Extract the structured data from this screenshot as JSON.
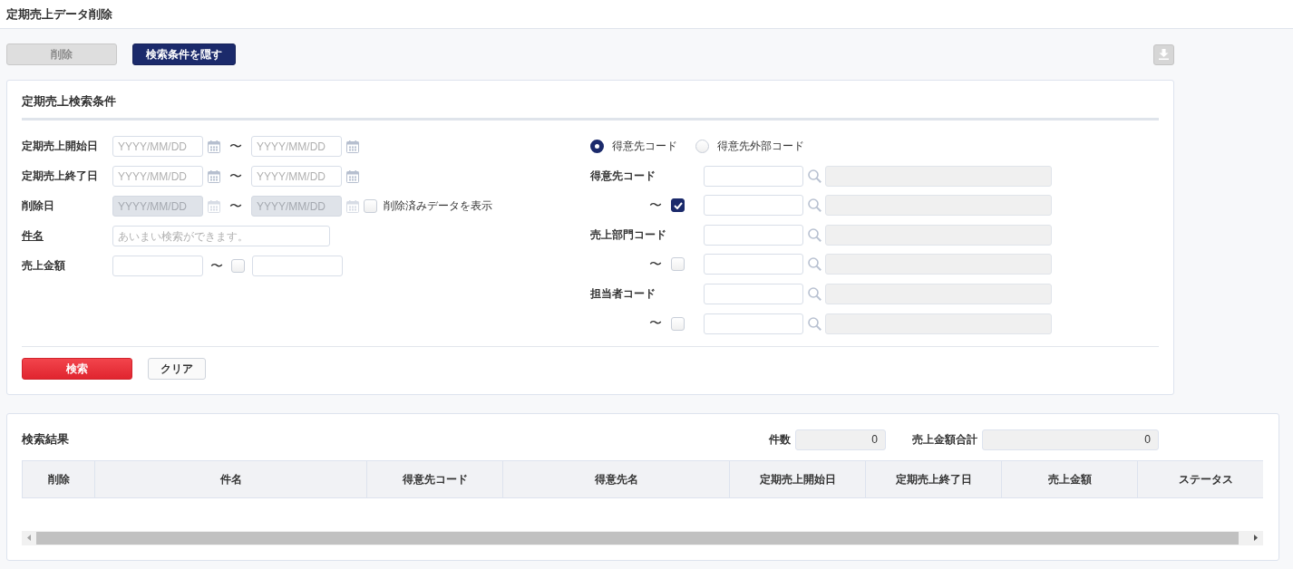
{
  "page": {
    "title": "定期売上データ削除"
  },
  "toolbar": {
    "buttons": [
      {
        "label": "削除",
        "kind": "plain",
        "disabled": true
      },
      {
        "label": "検索条件を隠す",
        "kind": "primary",
        "disabled": false
      }
    ],
    "download_button": {
      "disabled": true
    }
  },
  "search_panel": {
    "title": "定期売上検索条件",
    "left_rows": [
      {
        "kind": "date_range",
        "label": "定期売上開始日",
        "link": false,
        "from_placeholder": "YYYY/MM/DD",
        "separator": "〜",
        "to_placeholder": "YYYY/MM/DD",
        "disabled": false
      },
      {
        "kind": "date_range",
        "label": "定期売上終了日",
        "link": false,
        "from_placeholder": "YYYY/MM/DD",
        "separator": "〜",
        "to_placeholder": "YYYY/MM/DD",
        "disabled": false
      },
      {
        "kind": "date_range",
        "label": "削除日",
        "link": false,
        "from_placeholder": "YYYY/MM/DD",
        "separator": "〜",
        "to_placeholder": "YYYY/MM/DD",
        "disabled": true,
        "option": {
          "label": "削除済みデータを表示",
          "checked": false
        }
      },
      {
        "kind": "text",
        "label": "件名",
        "link": true,
        "placeholder": "あいまい検索ができます。"
      },
      {
        "kind": "amount_range",
        "label": "売上金額",
        "link": false,
        "separator": "〜",
        "checked": false
      }
    ],
    "code_type": [
      {
        "label": "得意先コード",
        "selected": true
      },
      {
        "label": "得意先外部コード",
        "selected": false
      }
    ],
    "code_groups": [
      {
        "label": "得意先コード",
        "separator": "〜",
        "checked": true
      },
      {
        "label": "売上部門コード",
        "separator": "〜",
        "checked": false
      },
      {
        "label": "担当者コード",
        "separator": "〜",
        "checked": false
      }
    ],
    "buttons": [
      {
        "label": "検索",
        "kind": "danger",
        "disabled": false
      },
      {
        "label": "クリア",
        "kind": "plain",
        "disabled": false
      }
    ]
  },
  "results": {
    "title": "検索結果",
    "totals": [
      {
        "label": "件数",
        "value": "0"
      },
      {
        "label": "売上金額合計",
        "value": "0"
      }
    ],
    "table": {
      "columns": [
        "削除",
        "件名",
        "得意先コード",
        "得意先名",
        "定期売上開始日",
        "定期売上終了日",
        "売上金額",
        "ステータス"
      ]
    }
  }
}
